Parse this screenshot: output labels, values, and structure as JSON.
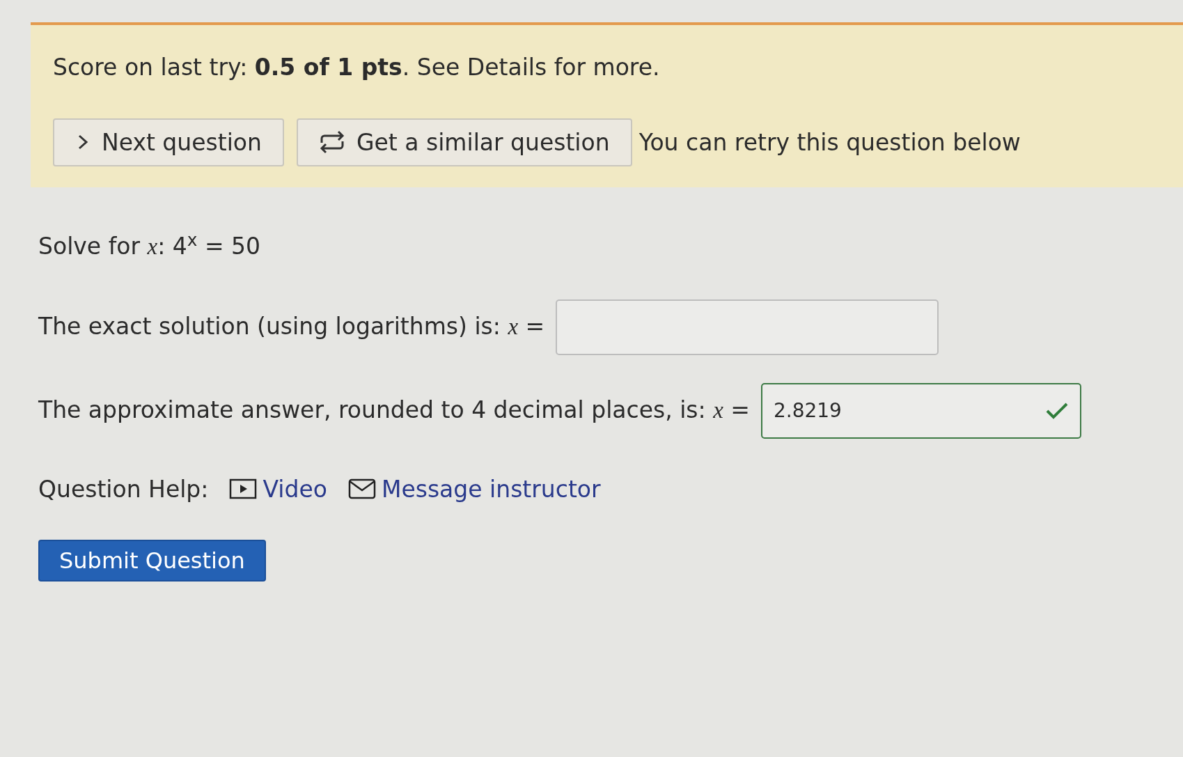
{
  "score": {
    "text": "Score on last try: **0.5 of 1 pts**. See Details for more."
  },
  "actions": [
    {
      "kind": "next",
      "label": "Next question"
    },
    {
      "kind": "similar",
      "label": "Get a similar question"
    }
  ],
  "retry_note": "You can retry this question below",
  "question": {
    "prompt": "Solve for *x*: 4$^{x}$ = 50",
    "parts": [
      {
        "label": "The exact solution (using logarithms) is: *x* =",
        "correct": false
      },
      {
        "label": "The approximate answer, rounded to 4 decimal places, is: *x* =",
        "value": "2.8219",
        "correct": true
      }
    ]
  },
  "help": {
    "label": "Question Help:",
    "links": [
      {
        "kind": "video",
        "label": "Video"
      },
      {
        "kind": "message",
        "label": "Message instructor"
      }
    ]
  },
  "submit": "Submit Question"
}
